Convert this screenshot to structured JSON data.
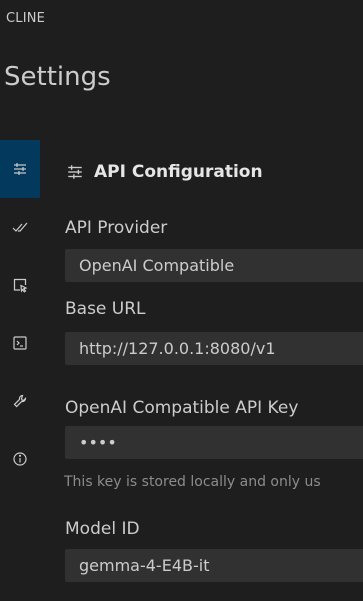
{
  "app": {
    "title": "CLINE"
  },
  "page": {
    "title": "Settings"
  },
  "rail": {
    "items": [
      {
        "name": "api-configuration",
        "icon": "sliders-icon",
        "active": true
      },
      {
        "name": "features",
        "icon": "double-check-icon",
        "active": false
      },
      {
        "name": "browser",
        "icon": "cursor-window-icon",
        "active": false
      },
      {
        "name": "terminal",
        "icon": "terminal-icon",
        "active": false
      },
      {
        "name": "debug",
        "icon": "wrench-icon",
        "active": false
      },
      {
        "name": "about",
        "icon": "info-icon",
        "active": false
      }
    ]
  },
  "section": {
    "title": "API Configuration",
    "icon": "sliders-icon"
  },
  "fields": {
    "api_provider": {
      "label": "API Provider",
      "value": "OpenAI Compatible"
    },
    "base_url": {
      "label": "Base URL",
      "value": "http://127.0.0.1:8080/v1"
    },
    "api_key": {
      "label": "OpenAI Compatible API Key",
      "value": "••••",
      "help": "This key is stored locally and only us"
    },
    "model_id": {
      "label": "Model ID",
      "value": "gemma-4-E4B-it"
    }
  },
  "colors": {
    "background": "#1e1e1e",
    "input_background": "#313131",
    "active_rail": "#04395e",
    "text": "#cccccc",
    "muted_text": "#8c8c8c"
  }
}
